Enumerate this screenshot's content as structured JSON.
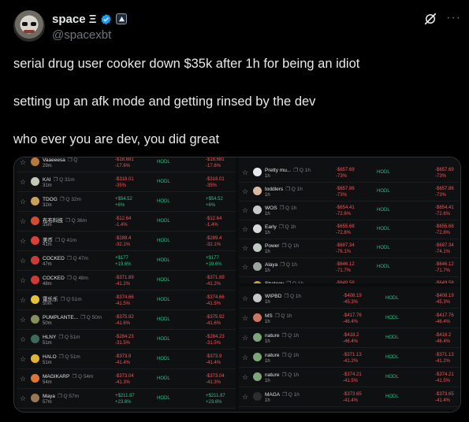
{
  "author": {
    "display_name": "space Ξ",
    "handle": "@spacexbt",
    "avatar_icon": "frog-avatar-icon",
    "verified_icon": "verified-badge-icon",
    "org_icon": "affiliate-badge-icon"
  },
  "actions": {
    "grok_icon": "grok-icon",
    "more_label": "···"
  },
  "tweet": {
    "lines": [
      "serial drug user cooker down $35k after 1h for being an idiot",
      "setting up an afk mode and getting rinsed by the dev",
      "who ever you are dev, you did great"
    ]
  },
  "media": {
    "status_label": "HODL",
    "left_panel": [
      {
        "name": "Vaaeeesa",
        "age": "29m",
        "pnl": "-$18,681",
        "pct": "-17.6%",
        "pnl2": "-$18,681",
        "pct2": "-17.6%",
        "sign": "neg",
        "color": "#b67a3c"
      },
      {
        "name": "KAI",
        "mini": "31m",
        "age": "31m",
        "pnl": "-$318.01",
        "pct": "-35%",
        "pnl2": "-$318.01",
        "pct2": "-35%",
        "sign": "neg",
        "color": "#c7c7b6"
      },
      {
        "name": "TDOG",
        "mini": "32m",
        "age": "32m",
        "pnl": "+$54.52",
        "pct": "+6%",
        "pnl2": "+$54.52",
        "pct2": "+6%",
        "sign": "pos",
        "color": "#caa25a"
      },
      {
        "name": "布布科技",
        "mini": "36m",
        "age": "35m",
        "pnl": "-$12.64",
        "pct": "-1.4%",
        "pnl2": "-$12.64",
        "pct2": "-1.4%",
        "sign": "neg",
        "color": "#d24c2f"
      },
      {
        "name": "美币",
        "mini": "41m",
        "age": "41m",
        "pnl": "-$289.4",
        "pct": "-32.1%",
        "pnl2": "-$289.4",
        "pct2": "-32.1%",
        "sign": "neg",
        "color": "#d8423a"
      },
      {
        "name": "COCKED",
        "mini": "47m",
        "age": "47m",
        "pnl": "+$177",
        "pct": "+19.6%",
        "pnl2": "+$177",
        "pct2": "+19.6%",
        "sign": "pos",
        "color": "#cc3b35"
      },
      {
        "name": "COCKED",
        "mini": "48m",
        "age": "48m",
        "pnl": "-$371.89",
        "pct": "-41.2%",
        "pnl2": "-$371.89",
        "pct2": "-41.2%",
        "sign": "neg",
        "color": "#cc3b35"
      },
      {
        "name": "雷乐乐",
        "mini": "51m",
        "age": "50m",
        "pnl": "-$374.66",
        "pct": "-41.5%",
        "pnl2": "-$374.66",
        "pct2": "-41.5%",
        "sign": "neg",
        "color": "#e6c13a"
      },
      {
        "name": "PUMPLANTE...",
        "mini": "50m",
        "age": "50m",
        "pnl": "-$375.92",
        "pct": "-41.6%",
        "pnl2": "-$375.92",
        "pct2": "-41.6%",
        "sign": "neg",
        "color": "#8a8f59"
      },
      {
        "name": "HLNY",
        "mini": "51m",
        "age": "51m",
        "pnl": "-$284.23",
        "pct": "-31.5%",
        "pnl2": "-$284.23",
        "pct2": "-31.5%",
        "sign": "neg",
        "color": "#3a6b58"
      },
      {
        "name": "HALO",
        "mini": "51m",
        "age": "51m",
        "pnl": "-$373.9",
        "pct": "-41.4%",
        "pnl2": "-$373.9",
        "pct2": "-41.4%",
        "sign": "neg",
        "color": "#e0b23c"
      },
      {
        "name": "MAGIKARP",
        "mini": "54m",
        "age": "54m",
        "pnl": "-$373.04",
        "pct": "-41.3%",
        "pnl2": "-$373.04",
        "pct2": "-41.3%",
        "sign": "neg",
        "color": "#e07435"
      },
      {
        "name": "Maya",
        "mini": "57m",
        "age": "57m",
        "pnl": "+$211.87",
        "pct": "+23.6%",
        "pnl2": "+$211.87",
        "pct2": "+23.6%",
        "sign": "pos",
        "color": "#9a7752"
      }
    ],
    "right_top_panel": [
      {
        "name": "Pretty mu...",
        "mini": "1h",
        "age": "1h",
        "pnl": "-$657.69",
        "pct": "-73%",
        "pnl2": "-$657.69",
        "pct2": "-73%",
        "sign": "neg",
        "color": "#e8e8e8"
      },
      {
        "name": "toddlers",
        "mini": "1h",
        "age": "1h",
        "pnl": "-$657.86",
        "pct": "-73%",
        "pnl2": "-$657.86",
        "pct2": "-73%",
        "sign": "neg",
        "color": "#d6b9a0"
      },
      {
        "name": "WOS",
        "mini": "1h",
        "age": "1h",
        "pnl": "-$654.41",
        "pct": "-72.6%",
        "pnl2": "-$654.41",
        "pct2": "-72.6%",
        "sign": "neg",
        "color": "#c8c8c8"
      },
      {
        "name": "Early",
        "mini": "1h",
        "age": "1h",
        "pnl": "-$655.68",
        "pct": "-72.8%",
        "pnl2": "-$655.68",
        "pct2": "-72.8%",
        "sign": "neg",
        "color": "#d9d9d9"
      },
      {
        "name": "Power",
        "mini": "1h",
        "age": "1h",
        "pnl": "-$687.34",
        "pct": "-76.1%",
        "pnl2": "-$687.34",
        "pct2": "-74.1%",
        "sign": "neg",
        "color": "#bfc9c2"
      },
      {
        "name": "Alaya",
        "mini": "1h",
        "age": "1h",
        "pnl": "-$646.12",
        "pct": "-71.7%",
        "pnl2": "-$646.12",
        "pct2": "-71.7%",
        "sign": "neg",
        "color": "#9aa59b"
      },
      {
        "name": "Strategy",
        "mini": "1h",
        "age": "1h",
        "pnl": "-$649.58",
        "pct": "-72.1%",
        "pnl2": "-$649.58",
        "pct2": "-72.1%",
        "sign": "neg",
        "color": "#c9a13b"
      }
    ],
    "right_bottom_panel": [
      {
        "name": "WIPBD",
        "mini": "1h",
        "age": "1h",
        "pnl": "-$408.19",
        "pct": "-45.3%",
        "pnl2": "-$408.19",
        "pct2": "-45.3%",
        "sign": "neg",
        "color": "#c6c6c6"
      },
      {
        "name": "MS",
        "mini": "1h",
        "age": "1h",
        "pnl": "-$417.76",
        "pct": "-46.4%",
        "pnl2": "-$417.76",
        "pct2": "-46.4%",
        "sign": "neg",
        "color": "#c97866"
      },
      {
        "name": "nature",
        "mini": "1h",
        "age": "1h",
        "pnl": "-$418.2",
        "pct": "-46.4%",
        "pnl2": "-$418.2",
        "pct2": "-46.4%",
        "sign": "neg",
        "color": "#7fa57a"
      },
      {
        "name": "nature",
        "mini": "1h",
        "age": "1h",
        "pnl": "-$371.13",
        "pct": "-41.2%",
        "pnl2": "-$371.13",
        "pct2": "-41.2%",
        "sign": "neg",
        "color": "#7fa57a"
      },
      {
        "name": "nature",
        "mini": "1h",
        "age": "1h",
        "pnl": "-$374.21",
        "pct": "-41.5%",
        "pnl2": "-$374.21",
        "pct2": "-41.5%",
        "sign": "neg",
        "color": "#7fa57a"
      },
      {
        "name": "MAGA",
        "mini": "1h",
        "age": "1h",
        "pnl": "-$373.65",
        "pct": "-41.4%",
        "pnl2": "-$373.65",
        "pct2": "-41.4%",
        "sign": "neg",
        "color": "#2d2d2d"
      }
    ]
  }
}
